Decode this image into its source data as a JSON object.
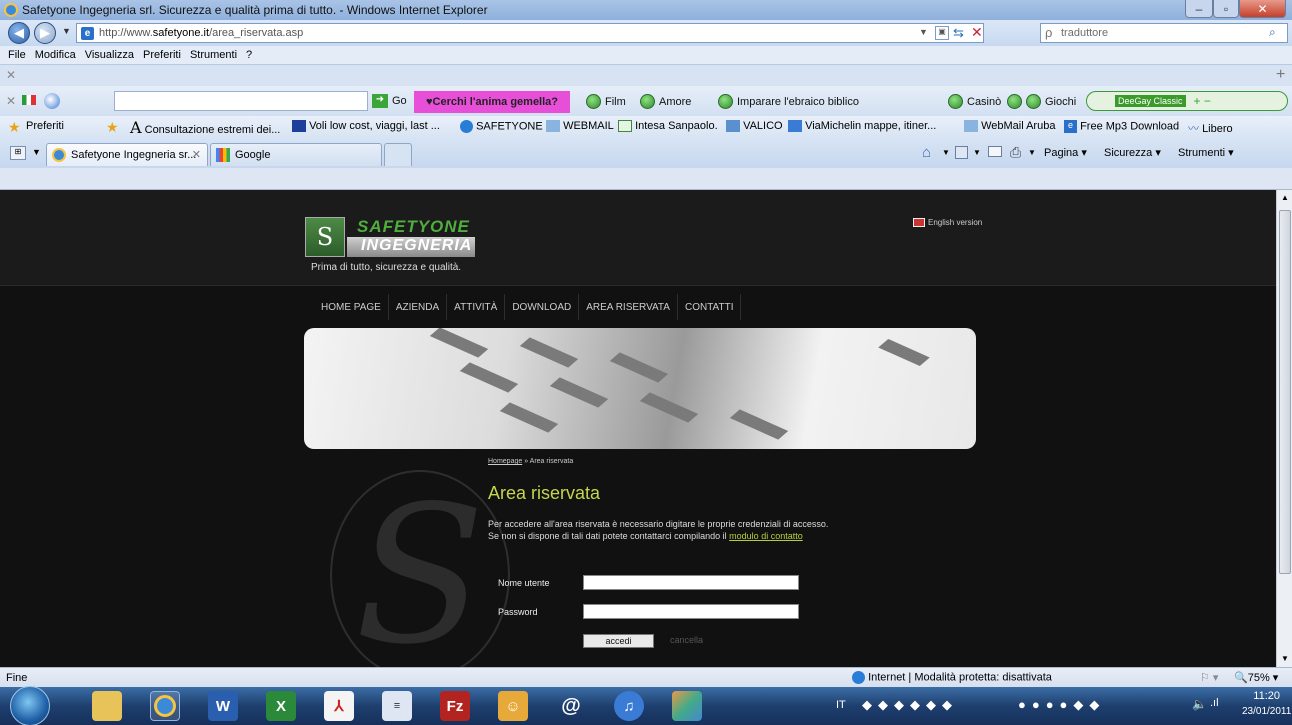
{
  "window": {
    "title": "Safetyone Ingegneria srl. Sicurezza e qualità prima di tutto. - Windows Internet Explorer"
  },
  "address": {
    "url_prefix": "http://www.",
    "url_domain": "safetyone.it",
    "url_path": "/area_riservata.asp",
    "search_placeholder": "traduttore"
  },
  "menu": [
    "File",
    "Modifica",
    "Visualizza",
    "Preferiti",
    "Strumenti",
    "?"
  ],
  "toolbar": {
    "go_label": "Go",
    "promo_label": "♥Cerchi l'anima gemella?",
    "film_label": "Film",
    "amore_label": "Amore",
    "ebraico_label": "Imparare l'ebraico biblico",
    "casino_label": "Casinò",
    "giochi_label": "Giochi",
    "radio_label": "DeeGay Classic"
  },
  "favorites": {
    "preferiti_label": "Preferiti",
    "items": [
      "Consultazione estremi dei...",
      "Voli low cost, viaggi, last ...",
      "SAFETYONE",
      "WEBMAIL",
      "Intesa Sanpaolo.",
      "VALICO",
      "ViaMichelin mappe, itiner...",
      "WebMail Aruba",
      "Free Mp3 Download",
      "Libero"
    ]
  },
  "tabs": [
    {
      "label": "Safetyone Ingegneria sr..."
    },
    {
      "label": "Google"
    }
  ],
  "commandbar": {
    "pagina": "Pagina",
    "sicurezza": "Sicurezza",
    "strumenti": "Strumenti"
  },
  "site": {
    "logo_line1": "SAFETYONE",
    "logo_line2": "INGEGNERIA",
    "logo_symbol": "S",
    "tagline": "Prima di tutto, sicurezza e qualità.",
    "english_version": "English version",
    "nav": [
      "HOME PAGE",
      "AZIENDA",
      "ATTIVITÀ",
      "DOWNLOAD",
      "AREA RISERVATA",
      "CONTATTI"
    ],
    "breadcrumb_home": "Homepage",
    "breadcrumb_current": "» Area riservata",
    "page_title": "Area riservata",
    "intro_line1": "Per accedere all'area riservata è necessario digitare le proprie credenziali di accesso.",
    "intro_line2": "Se non si dispone di tali dati potete contattarci compilando il",
    "intro_link": "modulo di contatto",
    "username_label": "Nome utente",
    "password_label": "Password",
    "username_value": "",
    "password_value": "",
    "login_button": "accedi",
    "cancel_button": "cancella"
  },
  "status": {
    "left": "Fine",
    "zone": "Internet | Modalità protetta: disattivata",
    "zoom": "75%"
  },
  "taskbar": {
    "lang": "IT",
    "time": "11:20",
    "date": "23/01/2011"
  }
}
